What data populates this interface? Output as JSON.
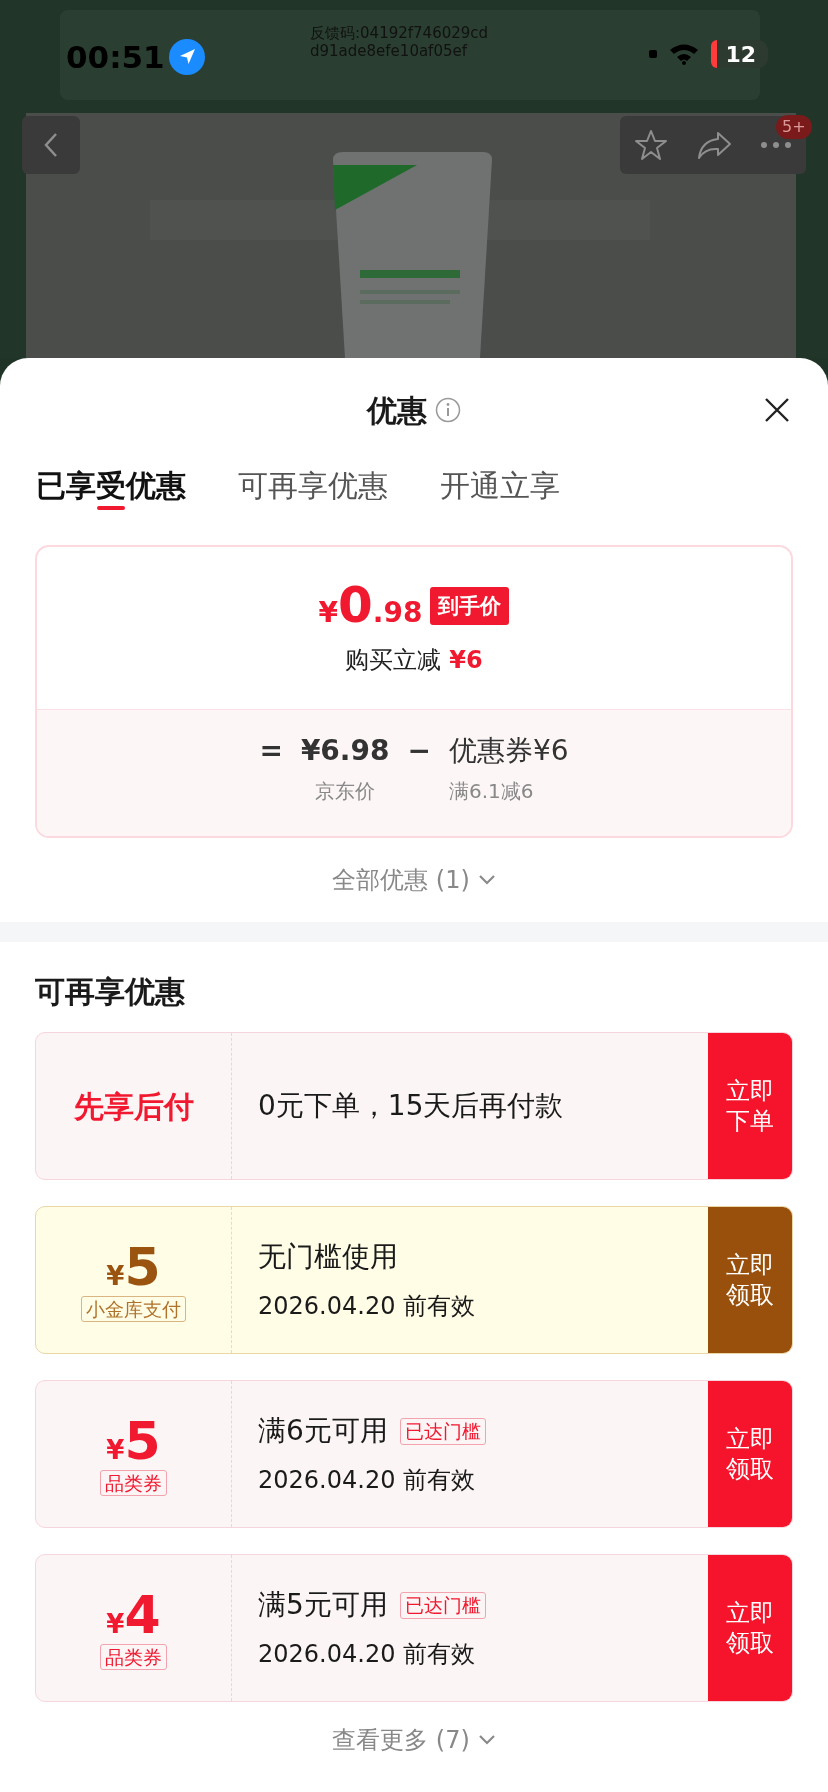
{
  "status_bar": {
    "time": "00:51",
    "feedback_code": [
      "反馈码:04192f746029cd",
      "d91ade8efe10af05ef"
    ],
    "battery": "12"
  },
  "product_page": {
    "cart_badge": "5+"
  },
  "sheet": {
    "title": "优惠",
    "tabs": [
      {
        "label": "已享受优惠",
        "selected": true
      },
      {
        "label": "可再享优惠",
        "selected": false
      },
      {
        "label": "开通立享",
        "selected": false
      }
    ],
    "price_card": {
      "currency": "¥",
      "price_integer": "0",
      "price_decimal": ".98",
      "price_tag": "到手价",
      "saving_label": "购买立减",
      "saving_amount": "¥6",
      "equals": "=",
      "base_price": "¥6.98",
      "base_label": "京东价",
      "minus": "−",
      "discount": "优惠券¥6",
      "discount_label": "满6.1减6"
    },
    "all_offers_link": "全部优惠 (1)",
    "section_title": "可再享优惠",
    "offers": [
      {
        "kind": "pay_later",
        "title": "先享后付",
        "description": "0元下单，15天后再付款",
        "button": "立即下单"
      },
      {
        "kind": "vault_coupon",
        "currency": "¥",
        "amount": "5",
        "tag": "小金库支付",
        "condition": "无门槛使用",
        "validity": "2026.04.20 前有效",
        "button": "立即领取"
      },
      {
        "kind": "coupon",
        "currency": "¥",
        "amount": "5",
        "tag": "品类券",
        "condition": "满6元可用",
        "badge": "已达门槛",
        "validity": "2026.04.20 前有效",
        "button": "立即领取"
      },
      {
        "kind": "coupon",
        "currency": "¥",
        "amount": "4",
        "tag": "品类券",
        "condition": "满5元可用",
        "badge": "已达门槛",
        "validity": "2026.04.20 前有效",
        "button": "立即领取"
      }
    ],
    "more_link": "查看更多 (7)"
  }
}
